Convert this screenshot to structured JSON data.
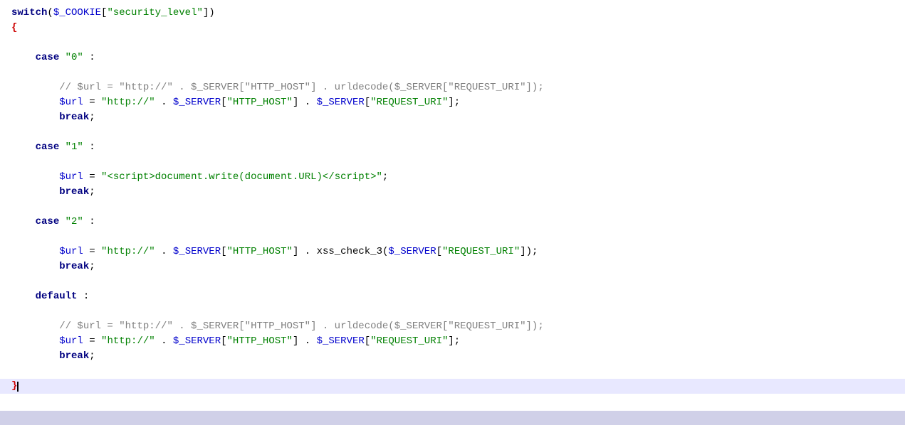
{
  "code": {
    "lines": [
      {
        "id": 1,
        "content": "switch_line",
        "highlight": false
      }
    ]
  },
  "colors": {
    "keyword": "#000080",
    "string": "#008000",
    "variable": "#0000cc",
    "comment": "#808080",
    "normal": "#000000",
    "bracket_red": "#cc0000",
    "background": "#ffffff",
    "bottom_bar": "#d0d0e8"
  }
}
